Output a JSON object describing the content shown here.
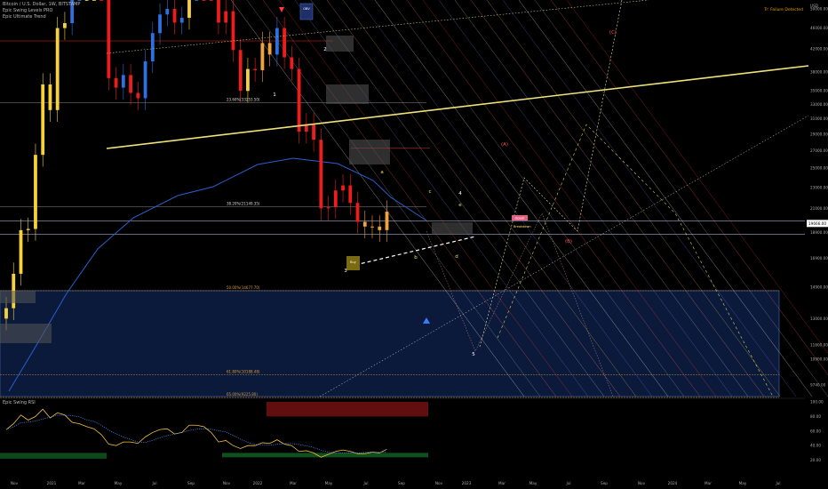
{
  "header": {
    "symbol_line": "Bitcoin / U.S. Dollar, 1W, BITSTAMP",
    "indicator_1": "Epic Swing Levels PRO",
    "indicator_2": "Epic Ultimate Trend",
    "corner_note": "Tr: Failure Detected"
  },
  "colors": {
    "background": "#000000",
    "bull_candle": "#f5d23a",
    "bear_candle": "#ee1c1c",
    "blue_candle": "#2f6fe0",
    "orange_candle": "#f2a23a",
    "trendline": "#f0e27a",
    "ma_line": "#2a5fd0",
    "target_box": "#0b1a3a"
  },
  "chart_data": [
    {
      "type": "candlestick",
      "title": "",
      "xlabel": "",
      "ylabel": "",
      "y_scale": "log",
      "ylim": [
        9000,
        52000
      ],
      "x_ticks": [
        "Nov",
        "2021",
        "Mar",
        "May",
        "Jul",
        "Sep",
        "Nov",
        "2022",
        "Mar",
        "May",
        "Jul",
        "Sep",
        "Nov",
        "2023",
        "Mar",
        "May",
        "Jul",
        "Sep",
        "Nov",
        "2024",
        "Mar",
        "May",
        "Jul"
      ],
      "y_ticks": [
        "USD",
        "50000.00",
        "46000.00",
        "42000.00",
        "38000.00",
        "35000.00",
        "33000.00",
        "31000.00",
        "29000.00",
        "27000.00",
        "25000.00",
        "23000.00",
        "21000.00",
        "18900.00",
        "16900.00",
        "14900.00",
        "13000.00",
        "11600.00",
        "10900.00",
        "9740.00"
      ],
      "last_price_labels": [
        "19666.00"
      ],
      "fib_levels": [
        {
          "label": "23.60%(33253.50)",
          "value": 33253.5
        },
        {
          "label": "38.20%(21149.35)",
          "value": 21149.35
        },
        {
          "label": "50.00%(14677.70)",
          "value": 14677.7
        },
        {
          "label": "61.80%(10188.48)",
          "value": 10188.48
        },
        {
          "label": "65.00%(9225.80)",
          "value": 9225.8
        }
      ],
      "annotations": [
        "(A)",
        "(B)",
        "(C)",
        "1",
        "2",
        "3",
        "4",
        "5",
        "a",
        "b",
        "c",
        "d",
        "e"
      ],
      "box_labels": {
        "signal_top": "OBV",
        "signal_bottom": "Buy",
        "target_1": "Upsell",
        "target_2": "Breakdown"
      },
      "series": [
        {
          "type": "candles",
          "x": [
            "2020-10-26",
            "2020-11-09",
            "2020-11-23",
            "2020-12-07",
            "2020-12-21",
            "2021-01-04",
            "2021-01-18",
            "2021-02-01",
            "2021-02-15",
            "2021-03-01",
            "2021-03-15",
            "2021-03-29",
            "2021-04-12",
            "2021-04-26",
            "2021-05-10",
            "2021-05-24",
            "2021-06-07",
            "2021-06-21",
            "2021-07-05",
            "2021-07-19",
            "2021-08-02",
            "2021-08-16",
            "2021-08-30",
            "2021-09-13",
            "2021-09-27",
            "2021-10-11",
            "2021-10-25",
            "2021-11-08",
            "2021-11-22",
            "2021-12-06",
            "2021-12-20",
            "2022-01-03",
            "2022-01-17",
            "2022-01-31",
            "2022-02-14",
            "2022-02-28",
            "2022-03-14",
            "2022-03-28",
            "2022-04-11",
            "2022-04-25",
            "2022-05-09",
            "2022-05-23",
            "2022-06-06",
            "2022-06-20",
            "2022-07-04",
            "2022-07-18",
            "2022-08-01",
            "2022-08-15",
            "2022-08-29",
            "2022-09-12",
            "2022-09-26",
            "2022-10-10",
            "2022-10-24"
          ],
          "close": [
            13600,
            15800,
            19100,
            19200,
            26500,
            36000,
            32200,
            46000,
            47000,
            57000,
            58000,
            59000,
            60000,
            56000,
            37000,
            35500,
            37500,
            34700,
            33900,
            39800,
            45000,
            48800,
            50000,
            47100,
            48100,
            61500,
            62000,
            64400,
            57000,
            47100,
            49500,
            41800,
            35000,
            38500,
            38300,
            43100,
            41000,
            46000,
            40500,
            38500,
            29300,
            30300,
            28300,
            21000,
            21100,
            22700,
            23200,
            21500,
            19800,
            19400,
            19400,
            19100,
            20700
          ],
          "color": [
            "bull",
            "bull",
            "bull",
            "bull",
            "bull",
            "bull",
            "bull",
            "bull",
            "bull",
            "blue",
            "blue",
            "bull",
            "bull",
            "bear",
            "bear",
            "bear",
            "blue",
            "bear",
            "bear",
            "blue",
            "blue",
            "blue",
            "blue",
            "bear",
            "blue",
            "bull",
            "blue",
            "bear",
            "bear",
            "bear",
            "bear",
            "bear",
            "bear",
            "bull",
            "bear",
            "orange",
            "orange",
            "blue",
            "bear",
            "bear",
            "bear",
            "bear",
            "bear",
            "bear",
            "bear",
            "bear",
            "bear",
            "bear",
            "bear",
            "orange",
            "orange",
            "orange",
            "orange"
          ]
        }
      ]
    },
    {
      "type": "line",
      "title": "Epic Swing RSI",
      "ylim": [
        0,
        100
      ],
      "y_ticks": [
        "100.00",
        "80.00",
        "60.00",
        "40.00",
        "20.00"
      ],
      "series": [
        {
          "name": "",
          "values": [
            62,
            70,
            82,
            75,
            80,
            90,
            78,
            85,
            82,
            72,
            70,
            66,
            63,
            55,
            42,
            40,
            45,
            45,
            43,
            52,
            58,
            62,
            63,
            56,
            58,
            68,
            68,
            66,
            58,
            45,
            47,
            40,
            36,
            40,
            40,
            44,
            43,
            48,
            42,
            40,
            32,
            33,
            30,
            24,
            28,
            32,
            34,
            32,
            29,
            29,
            31,
            30,
            35
          ]
        }
      ]
    }
  ]
}
